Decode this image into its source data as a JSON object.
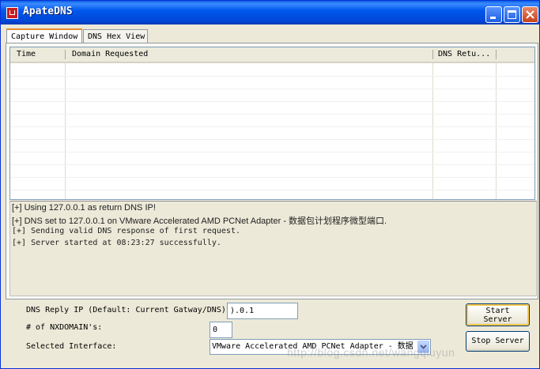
{
  "window": {
    "title": "ApateDNS"
  },
  "tabs": [
    {
      "label": "Capture Window",
      "active": true
    },
    {
      "label": "DNS Hex View",
      "active": false
    }
  ],
  "table": {
    "columns": [
      "Time",
      "Domain Requested",
      "DNS Retu..."
    ],
    "rows": []
  },
  "log": [
    "[+] Using 127.0.0.1 as return DNS IP!",
    "[+] DNS set to 127.0.0.1 on VMware Accelerated AMD PCNet Adapter - 数据包计划程序微型端口.",
    "[+] Sending valid DNS response of first request.",
    "[+] Server started at 08:23:27 successfully."
  ],
  "form": {
    "reply_ip_label": "DNS Reply IP (Default: Current Gatway/DNS):",
    "reply_ip_value": ").0.1",
    "nxdomain_label": "# of NXDOMAIN's:",
    "nxdomain_value": "0",
    "interface_label": "Selected Interface:",
    "interface_value": "VMware Accelerated AMD PCNet Adapter - 数据"
  },
  "buttons": {
    "start_line1": "Start",
    "start_line2": "Server",
    "stop": "Stop Server"
  },
  "watermark": "http://blog.csdn.net/wangqiuyun",
  "colors": {
    "titlebar": "#0058ee",
    "window_bg": "#ece9d8",
    "close_button": "#c7401c"
  }
}
